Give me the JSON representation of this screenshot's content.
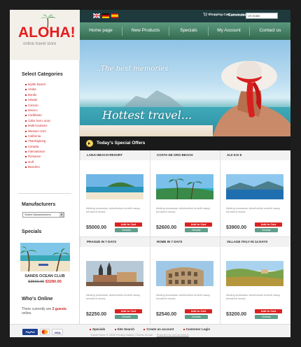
{
  "logo": {
    "text": "ALOHA!",
    "tagline": "online travel store"
  },
  "topbar": {
    "cart_label": "Shopping Cart",
    "cart_suffix": "now in your cart",
    "cart_items": "0 items",
    "currencies_label": "Currencies:",
    "currency_value": "US Dollar"
  },
  "nav": [
    "Home page",
    "New Products",
    "Specials",
    "My Account",
    "Contact us"
  ],
  "hero": {
    "line1": "...The best memories",
    "line2": "Hottest travel..."
  },
  "offers_title": "Today's Special Offers",
  "sidebar": {
    "categories_title": "Select Categories",
    "categories": [
      "Myrtle Beach",
      "Aruba",
      "Bonds",
      "Hawaii",
      "Cancun",
      "Mexico",
      "Caribbean",
      "Cabo San Lucas",
      "Multi-locations",
      "Western USA",
      "California",
      "Thanksgiving",
      "Canada",
      "International",
      "Romance",
      "Golf",
      "Beaches"
    ],
    "manufacturers_title": "Manufacturers",
    "manufacturers_select": "Select Manufacturers",
    "specials_title": "Specials",
    "special_name": "SANDS OCEAN CLUB",
    "special_old_price": "$3560.00",
    "special_new_price": "$3280.00",
    "online_title": "Who's Online",
    "online_prefix": "There currently are",
    "online_count": "2 guests",
    "online_suffix": "online."
  },
  "product_desc": "Aliciing erarsmiac delorfocibul molelti vasuy hendrerit mavis.",
  "buttons": {
    "add_to_cart": "Add to Cart",
    "details": "Details"
  },
  "products": [
    {
      "name": "LANAI BEACH RESORT",
      "price": "$5000.00"
    },
    {
      "name": "COSTA DE ORO BEACH",
      "price": "$2600.00"
    },
    {
      "name": "ALII KAI II",
      "price": "$3900.00"
    },
    {
      "name": "PRAGUE IN 7 DAYS",
      "price": "$2250.00"
    },
    {
      "name": "ROME IN 7 DAYS",
      "price": "$2540.00"
    },
    {
      "name": "VILLAGE ITALY IN 14 DAYS",
      "price": "$3200.00"
    }
  ],
  "payment": [
    "PayPal",
    "VISA"
  ],
  "footer": {
    "links": [
      "Specials",
      "Site Search",
      "Create an account",
      "Customer Login"
    ],
    "copyright": "Travel Store © 2006  Privacy Notice | Terms of Use",
    "powered": "Powered by osCommerce"
  },
  "colors": {
    "accent_red": "#d02525",
    "nav_green": "#3a6e59",
    "topbar_dark": "#1f3a3d",
    "background": "#1d1d1d"
  }
}
